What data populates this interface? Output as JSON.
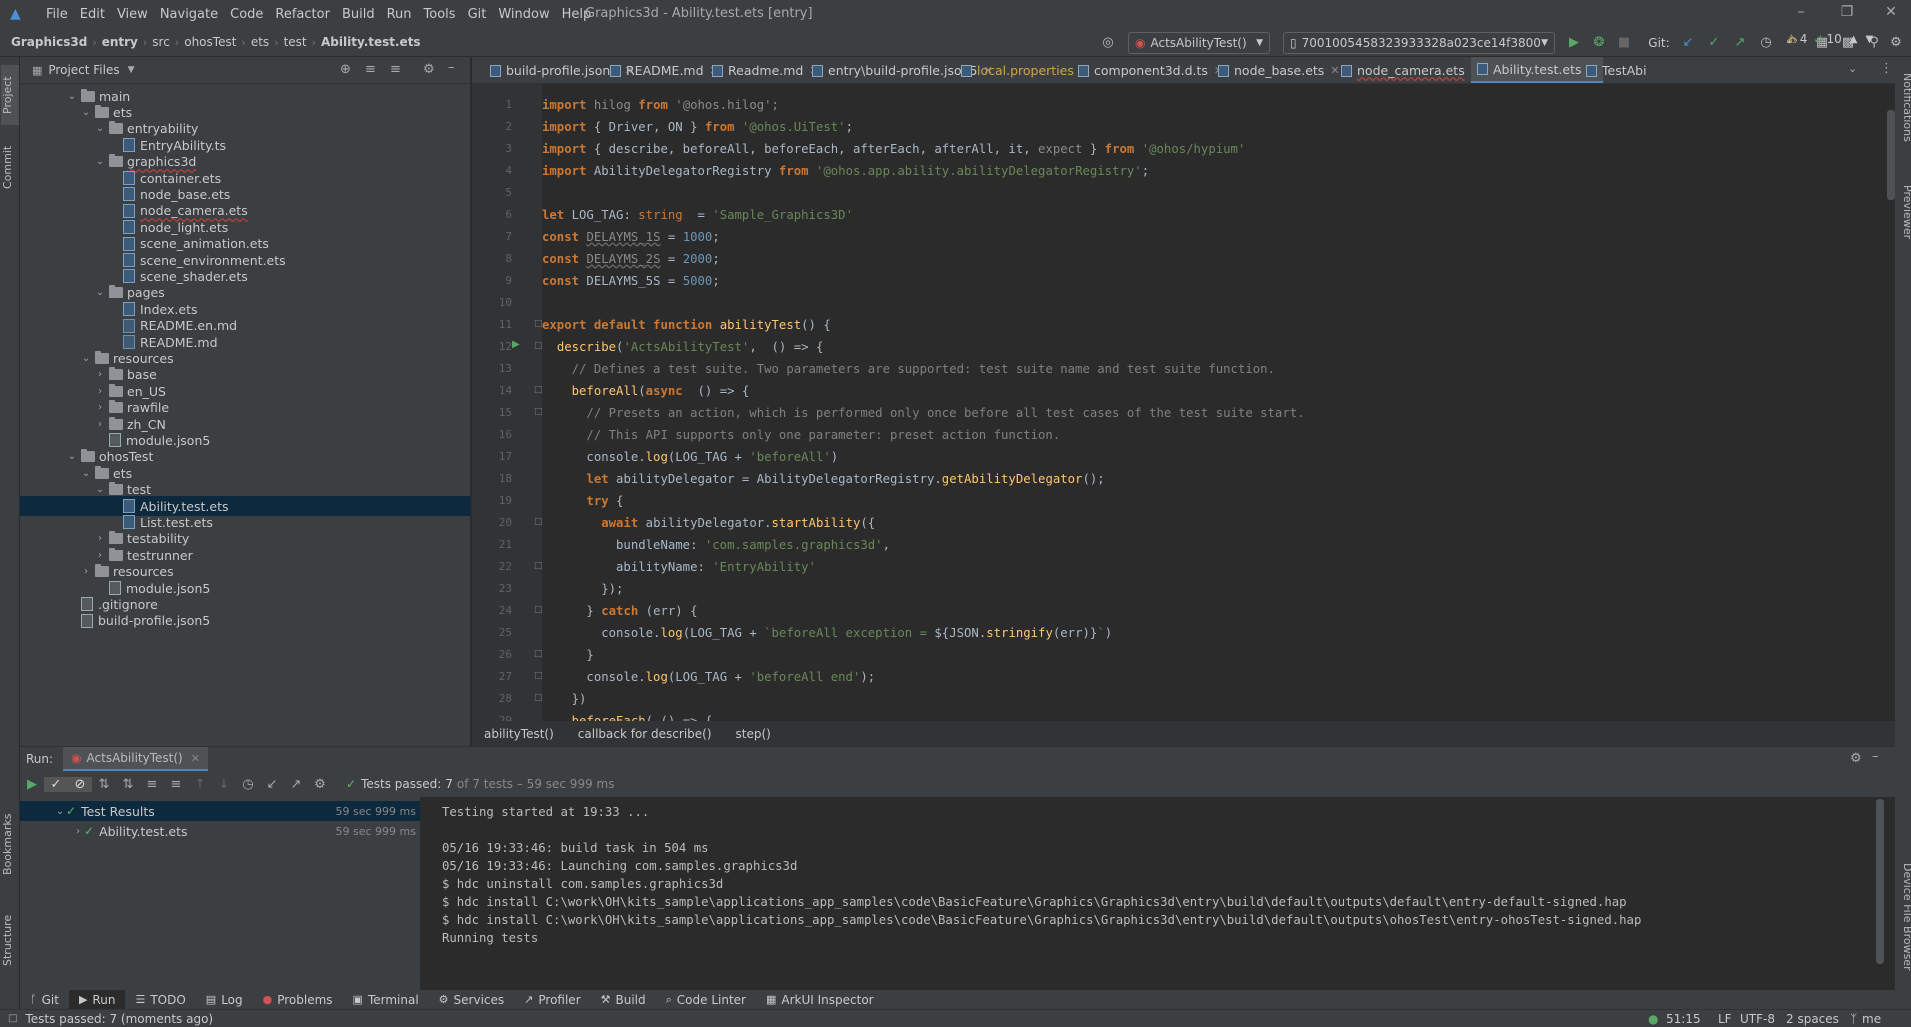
{
  "app": {
    "title": "Graphics3d - Ability.test.ets [entry]"
  },
  "menu": [
    "File",
    "Edit",
    "View",
    "Navigate",
    "Code",
    "Refactor",
    "Build",
    "Run",
    "Tools",
    "Git",
    "Window",
    "Help"
  ],
  "breadcrumb": [
    "Graphics3d",
    "entry",
    "src",
    "ohosTest",
    "ets",
    "test",
    "Ability.test.ets"
  ],
  "toolbar": {
    "run_config": "ActsAbilityTest()",
    "device": "7001005458323933328a023ce14f3800",
    "git_label": "Git:"
  },
  "project_panel": {
    "title": "Project Files"
  },
  "tree": [
    {
      "label": "main",
      "depth": 3,
      "type": "folder",
      "open": true
    },
    {
      "label": "ets",
      "depth": 4,
      "type": "folder",
      "open": true
    },
    {
      "label": "entryability",
      "depth": 5,
      "type": "folder",
      "open": true
    },
    {
      "label": "EntryAbility.ts",
      "depth": 6,
      "type": "file"
    },
    {
      "label": "graphics3d",
      "depth": 5,
      "type": "folder",
      "open": true,
      "err": true
    },
    {
      "label": "container.ets",
      "depth": 6,
      "type": "file"
    },
    {
      "label": "node_base.ets",
      "depth": 6,
      "type": "file"
    },
    {
      "label": "node_camera.ets",
      "depth": 6,
      "type": "file",
      "err": true
    },
    {
      "label": "node_light.ets",
      "depth": 6,
      "type": "file"
    },
    {
      "label": "scene_animation.ets",
      "depth": 6,
      "type": "file"
    },
    {
      "label": "scene_environment.ets",
      "depth": 6,
      "type": "file"
    },
    {
      "label": "scene_shader.ets",
      "depth": 6,
      "type": "file"
    },
    {
      "label": "pages",
      "depth": 5,
      "type": "folder",
      "open": true
    },
    {
      "label": "Index.ets",
      "depth": 6,
      "type": "file"
    },
    {
      "label": "README.en.md",
      "depth": 6,
      "type": "md"
    },
    {
      "label": "README.md",
      "depth": 6,
      "type": "md"
    },
    {
      "label": "resources",
      "depth": 4,
      "type": "folder",
      "open": true
    },
    {
      "label": "base",
      "depth": 5,
      "type": "folder",
      "open": false
    },
    {
      "label": "en_US",
      "depth": 5,
      "type": "folder",
      "open": false
    },
    {
      "label": "rawfile",
      "depth": 5,
      "type": "folder",
      "open": false
    },
    {
      "label": "zh_CN",
      "depth": 5,
      "type": "folder",
      "open": false
    },
    {
      "label": "module.json5",
      "depth": 5,
      "type": "js"
    },
    {
      "label": "ohosTest",
      "depth": 3,
      "type": "folder",
      "open": true
    },
    {
      "label": "ets",
      "depth": 4,
      "type": "folder",
      "open": true
    },
    {
      "label": "test",
      "depth": 5,
      "type": "folder",
      "open": true
    },
    {
      "label": "Ability.test.ets",
      "depth": 6,
      "type": "file",
      "selected": true
    },
    {
      "label": "List.test.ets",
      "depth": 6,
      "type": "file"
    },
    {
      "label": "testability",
      "depth": 5,
      "type": "folder",
      "open": false
    },
    {
      "label": "testrunner",
      "depth": 5,
      "type": "folder",
      "open": false
    },
    {
      "label": "resources",
      "depth": 4,
      "type": "folder",
      "open": false
    },
    {
      "label": "module.json5",
      "depth": 5,
      "type": "js"
    },
    {
      "label": ".gitignore",
      "depth": 3,
      "type": "js"
    },
    {
      "label": "build-profile.json5",
      "depth": 3,
      "type": "js"
    }
  ],
  "tabs": [
    {
      "label": "build-profile.json5"
    },
    {
      "label": "README.md"
    },
    {
      "label": "Readme.md"
    },
    {
      "label": "entry\\build-profile.json5"
    },
    {
      "label": "local.properties"
    },
    {
      "label": "component3d.d.ts"
    },
    {
      "label": "node_base.ets"
    },
    {
      "label": "node_camera.ets"
    },
    {
      "label": "Ability.test.ets"
    },
    {
      "label": "TestAbi"
    }
  ],
  "inspections": {
    "warnings": "4",
    "ok": "10"
  },
  "code_lines": [
    "<span class='k'>import</span> <span class='dim'>hilog</span> <span class='k'>from</span> <span class='s dim'>'@ohos.hilog'</span><span class='dim'>;</span>",
    "<span class='k'>import</span> { Driver, ON } <span class='k'>from</span> <span class='s'>'@ohos.UiTest'</span>;",
    "<span class='k'>import</span> { describe, beforeAll, beforeEach, afterEach, afterAll, it, <span class='dim'>expect</span> } <span class='k'>from</span> <span class='s'>'@ohos/hypium'</span>",
    "<span class='k'>import</span> AbilityDelegatorRegistry <span class='k'>from</span> <span class='s'>'@ohos.app.ability.abilityDelegatorRegistry'</span>;",
    "",
    "<span class='k'>let</span> LOG_TAG: <span class='t'>string</span>  = <span class='s'>'Sample_Graphics3D'</span>",
    "<span class='k'>const</span> <span class='dim uwav'>DELAYMS_1S</span> = <span class='n'>1000</span>;",
    "<span class='k'>const</span> <span class='dim uwav'>DELAYMS_2S</span> = <span class='n'>2000</span>;",
    "<span class='k'>const</span> DELAYMS_5S = <span class='n'>5000</span>;",
    "",
    "<span class='k'>export default function</span> <span class='f'>abilityTest</span>() {",
    "  <span class='f'>describe</span>(<span class='s'>'ActsAbilityTest'</span>,  () => {",
    "    <span class='c'>// Defines a test suite. Two parameters are supported: test suite name and test suite function.</span>",
    "    <span class='f'>beforeAll</span>(<span class='k'>async</span>  () => {",
    "      <span class='c'>// Presets an action, which is performed only once before all test cases of the test suite start.</span>",
    "      <span class='c'>// This API supports only one parameter: preset action function.</span>",
    "      console.<span class='f'>log</span>(LOG_TAG + <span class='s'>'beforeAll'</span>)",
    "      <span class='k'>let</span> abilityDelegator = AbilityDelegatorRegistry.<span class='f'>getAbilityDelegator</span>();",
    "      <span class='k'>try</span> {",
    "        <span class='k'>await</span> abilityDelegator.<span class='f'>startAbility</span>({",
    "          bundleName: <span class='s'>'com.samples.graphics3d'</span>,",
    "          abilityName: <span class='s'>'EntryAbility'</span>",
    "        });",
    "      } <span class='k'>catch</span> (err) {",
    "        console.<span class='f'>log</span>(LOG_TAG + <span class='s'>`beforeAll exception = </span>${JSON.<span class='f'>stringify</span>(err)}<span class='s'>`</span>)",
    "      }",
    "      console.<span class='f'>log</span>(LOG_TAG + <span class='s'>'beforeAll end'</span>);",
    "    })",
    "    <span class='f'>beforeEach</span>( () => {"
  ],
  "crumbs": [
    "abilityTest()",
    "callback for describe()",
    "step()"
  ],
  "run": {
    "label": "Run:",
    "config": "ActsAbilityTest()",
    "summary_prefix": "Tests passed:",
    "summary_count": "7",
    "summary_rest": "of 7 tests – 59 sec 999 ms",
    "results": [
      {
        "label": "Test Results",
        "time": "59 sec 999 ms"
      },
      {
        "label": "Ability.test.ets",
        "time": "59 sec 999 ms"
      }
    ],
    "console": [
      "Testing started at 19:33 ...",
      "",
      "05/16 19:33:46: build task in 504 ms",
      "05/16 19:33:46: Launching com.samples.graphics3d",
      "$ hdc uninstall com.samples.graphics3d",
      "$ hdc install C:\\work\\OH\\kits_sample\\applications_app_samples\\code\\BasicFeature\\Graphics\\Graphics3d\\entry\\build\\default\\outputs\\default\\entry-default-signed.hap",
      "$ hdc install C:\\work\\OH\\kits_sample\\applications_app_samples\\code\\BasicFeature\\Graphics\\Graphics3d\\entry\\build\\default\\outputs\\ohosTest\\entry-ohosTest-signed.hap",
      "Running tests"
    ]
  },
  "bottom_tabs": [
    {
      "label": "Git",
      "icon": "git-icon"
    },
    {
      "label": "Run",
      "icon": "run-icon"
    },
    {
      "label": "TODO",
      "icon": "todo-icon"
    },
    {
      "label": "Log",
      "icon": "log-icon"
    },
    {
      "label": "Problems",
      "icon": "problems-icon"
    },
    {
      "label": "Terminal",
      "icon": "terminal-icon"
    },
    {
      "label": "Services",
      "icon": "services-icon"
    },
    {
      "label": "Profiler",
      "icon": "profiler-icon"
    },
    {
      "label": "Build",
      "icon": "build-icon"
    },
    {
      "label": "Code Linter",
      "icon": "linter-icon"
    },
    {
      "label": "ArkUI Inspector",
      "icon": "inspector-icon"
    }
  ],
  "status": {
    "message": "Tests passed: 7 (moments ago)",
    "position": "51:15",
    "line_sep": "LF",
    "encoding": "UTF-8",
    "indent": "2 spaces",
    "user": "me"
  },
  "side_tabs": {
    "left_top": [
      "Project",
      "Commit"
    ],
    "left_bottom": [
      "Bookmarks",
      "Structure"
    ],
    "right_top": [
      "Notifications",
      "Previewer"
    ],
    "right_bottom": [
      "Device File Browser"
    ]
  }
}
